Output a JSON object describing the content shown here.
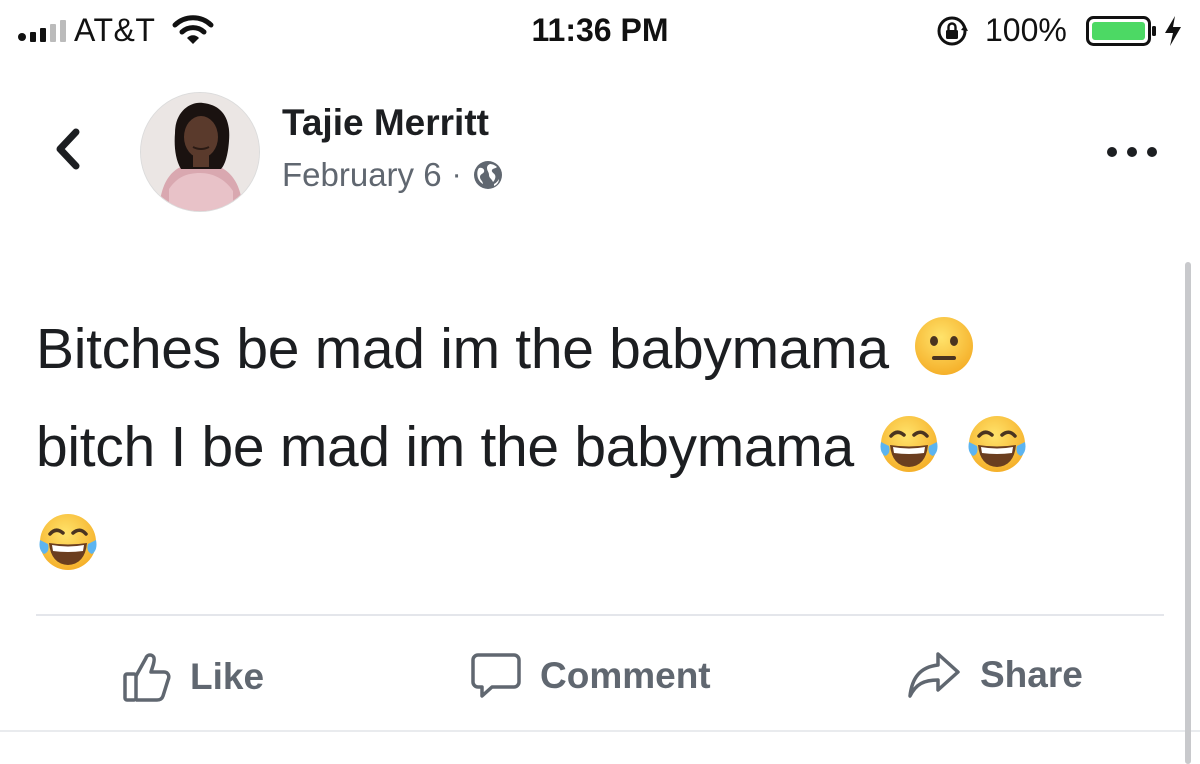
{
  "status_bar": {
    "carrier": "AT&T",
    "time": "11:36 PM",
    "battery_percent": "100%",
    "icons": [
      "signal-icon",
      "wifi-icon",
      "orientation-lock-icon",
      "battery-icon",
      "charging-bolt-icon"
    ]
  },
  "post": {
    "author": "Tajie Merritt",
    "date": "February 6",
    "separator": "·",
    "privacy_icon": "globe-icon",
    "lines": [
      {
        "text": "Bitches be mad im the babymama",
        "emojis": [
          "neutral-face"
        ]
      },
      {
        "text": "bitch I be mad im the babymama",
        "emojis": [
          "tears-of-joy",
          "tears-of-joy"
        ]
      },
      {
        "text": "",
        "emojis": [
          "tears-of-joy"
        ]
      }
    ]
  },
  "actions": {
    "like": "Like",
    "comment": "Comment",
    "share": "Share"
  },
  "colors": {
    "text": "#1c1e21",
    "secondary": "#606770",
    "battery_fill": "#4cd964",
    "divider": "#e4e6eb"
  }
}
